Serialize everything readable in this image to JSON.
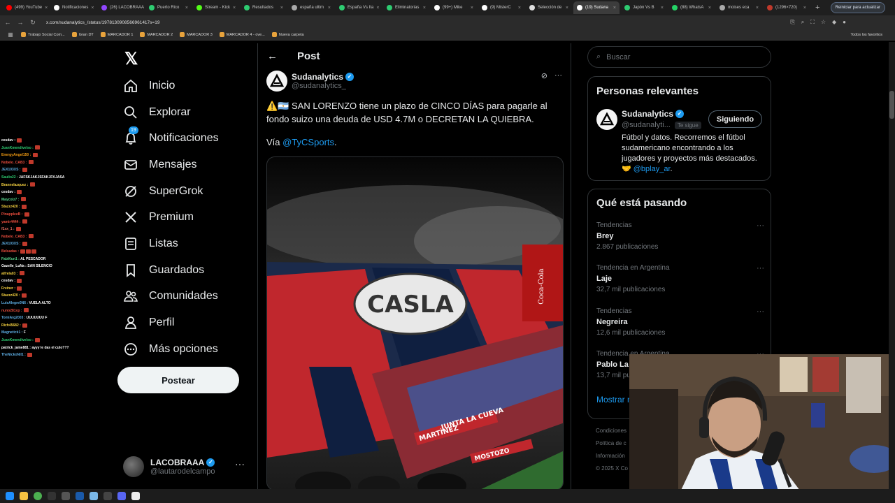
{
  "browser": {
    "tabs": [
      {
        "label": "(499) YouTube",
        "color": "#ff0000"
      },
      {
        "label": "Notificaciones",
        "color": "#ffffff"
      },
      {
        "label": "(26) LACOBRAAA",
        "color": "#9146ff"
      },
      {
        "label": "Puerto Rico",
        "color": "#2ecc71"
      },
      {
        "label": "Stream - Kick",
        "color": "#53fc18"
      },
      {
        "label": "Resultados",
        "color": "#2ecc71"
      },
      {
        "label": "españa ultim",
        "color": "#aaaaaa"
      },
      {
        "label": "España Vs Ita",
        "color": "#2ecc71"
      },
      {
        "label": "Eliminatorias",
        "color": "#2ecc71"
      },
      {
        "label": "(99+) Mike",
        "color": "#ffffff"
      },
      {
        "label": "(9) MisterC",
        "color": "#ffffff"
      },
      {
        "label": "Selección de",
        "color": "#dddddd"
      },
      {
        "label": "(19) Sudana",
        "color": "#ffffff"
      },
      {
        "label": "Japón Vs B",
        "color": "#2ecc71"
      },
      {
        "label": "(88) WhatsA",
        "color": "#25d366"
      },
      {
        "label": "moises eca",
        "color": "#aaaaaa"
      },
      {
        "label": "(1296×720)",
        "color": "#c0392b"
      }
    ],
    "active_tab_index": 12,
    "url": "x.com/sudanalytics_/status/1978130908566961417s=19",
    "update_button": "Reiniciar para actualizar",
    "bookmarks": [
      "Trabajo Social Com...",
      "Gran DT",
      "MARCADOR 1",
      "MARCADOR 2",
      "MARCADOR 3",
      "MARCADOR 4 - ove...",
      "Nueva carpeta"
    ],
    "all_bookmarks": "Todos los favoritos"
  },
  "chat": [
    {
      "user": "cesdav :",
      "msg": "",
      "color": "#ffffff",
      "emotes": 1
    },
    {
      "user": "JuanKmendivelso :",
      "msg": "",
      "color": "#2ecc71",
      "emotes": 1
    },
    {
      "user": "EnergyAngel150 :",
      "msg": "",
      "color": "#f39c12",
      "emotes": 1
    },
    {
      "user": "Nobelo_CAB3 :",
      "msg": "",
      "color": "#e74c3c",
      "emotes": 1
    },
    {
      "user": "JEX103XS :",
      "msg": "",
      "color": "#5dade2",
      "emotes": 1
    },
    {
      "user": "Saulio22 :",
      "msg": "JAFSKJAKJSFAKJFKJASA",
      "color": "#2ecc71",
      "emotes": 0
    },
    {
      "user": "Brannelazquez :",
      "msg": "",
      "color": "#f4d03f",
      "emotes": 1
    },
    {
      "user": "cesdav :",
      "msg": "",
      "color": "#ffffff",
      "emotes": 1
    },
    {
      "user": "Maycolz7 :",
      "msg": "",
      "color": "#58d68d",
      "emotes": 1
    },
    {
      "user": "Stazzz420 :",
      "msg": "",
      "color": "#f4d03f",
      "emotes": 1
    },
    {
      "user": "PinappleeB :",
      "msg": "",
      "color": "#e74c3c",
      "emotes": 1
    },
    {
      "user": "yamir4444 :",
      "msg": "",
      "color": "#e74c3c",
      "emotes": 1
    },
    {
      "user": "f1xx_1 :",
      "msg": "",
      "color": "#ec7063",
      "emotes": 1
    },
    {
      "user": "Nobelo_CAB3 :",
      "msg": "",
      "color": "#e74c3c",
      "emotes": 1
    },
    {
      "user": "JEX103XS :",
      "msg": "",
      "color": "#5dade2",
      "emotes": 1
    },
    {
      "user": "Belsadas :",
      "msg": "",
      "color": "#e74c3c",
      "emotes": 3
    },
    {
      "user": "FabiKun1 :",
      "msg": "AL PESCADOR",
      "color": "#58d68d",
      "emotes": 0
    },
    {
      "user": "Gazelle_LuNa :",
      "msg": "SAN SILENCIO",
      "color": "#ffffff",
      "emotes": 0
    },
    {
      "user": "alfrela03 :",
      "msg": "",
      "color": "#f4d03f",
      "emotes": 1
    },
    {
      "user": "cesdav :",
      "msg": "",
      "color": "#ffffff",
      "emotes": 1
    },
    {
      "user": "Freiner :",
      "msg": "",
      "color": "#f4d03f",
      "emotes": 1
    },
    {
      "user": "Stazzz420 :",
      "msg": "",
      "color": "#f4d03f",
      "emotes": 1
    },
    {
      "user": "LuisAlegre0N6 :",
      "msg": "VUELA ALTO",
      "color": "#5dade2",
      "emotes": 0
    },
    {
      "user": "nuno281xp :",
      "msg": "",
      "color": "#e74c3c",
      "emotes": 1
    },
    {
      "user": "TomiArg2003 :",
      "msg": "UUUUUUU F",
      "color": "#5dade2",
      "emotes": 0
    },
    {
      "user": "Rich45682 :",
      "msg": "",
      "color": "#f4d03f",
      "emotes": 1
    },
    {
      "user": "Magnetick1 :",
      "msg": "F",
      "color": "#5dade2",
      "emotes": 0
    },
    {
      "user": "JuanKmendivelso :",
      "msg": "",
      "color": "#2ecc71",
      "emotes": 1
    },
    {
      "user": "patrick_jame881 :",
      "msg": "ayyy le das el culo???",
      "color": "#ffffff",
      "emotes": 0
    },
    {
      "user": "TheNickoNil1 :",
      "msg": "",
      "color": "#5dade2",
      "emotes": 1
    }
  ],
  "nav": {
    "items": [
      {
        "label": "Inicio",
        "icon": "home-icon"
      },
      {
        "label": "Explorar",
        "icon": "search-icon"
      },
      {
        "label": "Notificaciones",
        "icon": "bell-icon"
      },
      {
        "label": "Mensajes",
        "icon": "mail-icon"
      },
      {
        "label": "SuperGrok",
        "icon": "grok-icon"
      },
      {
        "label": "Premium",
        "icon": "x-premium-icon"
      },
      {
        "label": "Listas",
        "icon": "list-icon"
      },
      {
        "label": "Guardados",
        "icon": "bookmark-icon"
      },
      {
        "label": "Comunidades",
        "icon": "communities-icon"
      },
      {
        "label": "Perfil",
        "icon": "person-icon"
      },
      {
        "label": "Más opciones",
        "icon": "more-circle-icon"
      }
    ],
    "notifications_badge": "19",
    "post_button": "Postear"
  },
  "account": {
    "display_name": "LACOBRAAA",
    "handle": "@lautarodelcampo"
  },
  "post": {
    "header_title": "Post",
    "author_name": "Sudanalytics",
    "author_handle": "@sudanalytics_",
    "text": "⚠️🇦🇷 SAN LORENZO tiene un plazo de CINCO DÍAS para pagarle al fondo suizo una deuda de USD 4.7M o DECRETAN LA QUIEBRA.",
    "via_prefix": "Vía ",
    "via_link": "@TyCSports",
    "via_suffix": ".",
    "image_text": {
      "banner1": "MARTÍNEZ",
      "banner2": "JUNTA LA CUEVA",
      "banner3": "MOSTOZO",
      "sponsor": "Coca-Cola"
    }
  },
  "right": {
    "search_placeholder": "Buscar",
    "relevant_title": "Personas relevantes",
    "relevant_name": "Sudanalytics",
    "relevant_handle": "@sudanalyti...",
    "follows_you": "Te sigue",
    "following_button": "Siguiendo",
    "relevant_bio": "Fútbol y datos. Recorremos el fútbol sudamericano encontrando a los jugadores y proyectos más destacados. 🤝 ",
    "relevant_bio_link": "@bplay_ar",
    "relevant_bio_end": ".",
    "trends_title": "Qué está pasando",
    "trends": [
      {
        "context": "Tendencias",
        "name": "Brey",
        "count": "2.867 publicaciones"
      },
      {
        "context": "Tendencia en Argentina",
        "name": "Laje",
        "count": "32,7 mil publicaciones"
      },
      {
        "context": "Tendencias",
        "name": "Negreira",
        "count": "12,6 mil publicaciones"
      },
      {
        "context": "Tendencia en Argentina",
        "name": "Pablo La",
        "count": "13,7 mil pu"
      }
    ],
    "show_more": "Mostrar m",
    "footer": [
      "Condiciones",
      "Política de c",
      "Información",
      "© 2025 X Co"
    ]
  }
}
